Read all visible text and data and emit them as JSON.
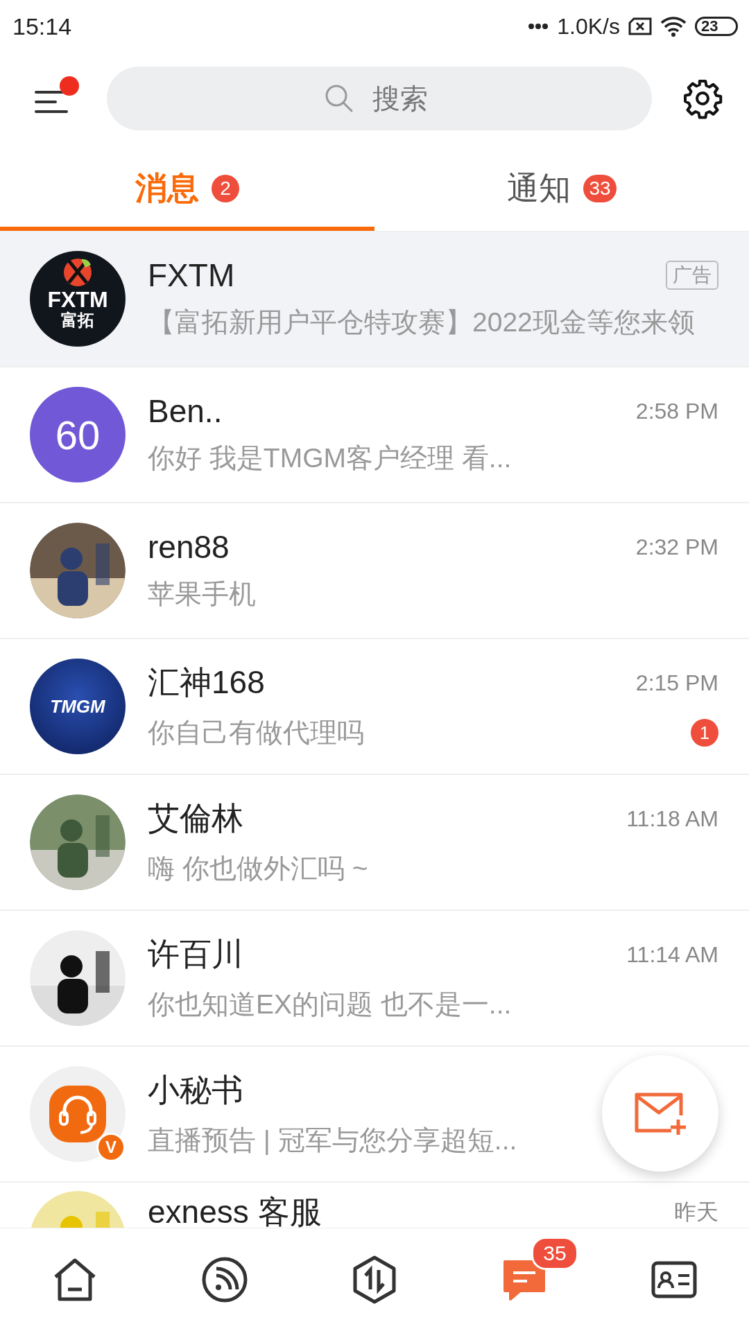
{
  "status_bar": {
    "time": "15:14",
    "net_speed": "1.0K/s",
    "battery": "23"
  },
  "header": {
    "menu_notification": true,
    "search": {
      "placeholder": "搜索"
    }
  },
  "tabs": [
    {
      "label": "消息",
      "badge": "2",
      "selected": true
    },
    {
      "label": "通知",
      "badge": "33",
      "selected": false
    }
  ],
  "conversations": [
    {
      "name": "FXTM",
      "preview": "【富拓新用户平仓特攻赛】2022现金等您来领",
      "tag": "广告",
      "highlighted": true,
      "avatar": {
        "kind": "logo",
        "text": "FXTM",
        "subtext": "富拓"
      }
    },
    {
      "name": "Ben..",
      "time": "2:58 PM",
      "preview": "你好 我是TMGM客户经理 看...",
      "highlighted": false,
      "avatar": {
        "kind": "initials",
        "text": "60",
        "color": "#7158d6"
      }
    },
    {
      "name": "ren88",
      "time": "2:32 PM",
      "preview": "苹果手机",
      "highlighted": false
    },
    {
      "name": "汇神168",
      "time": "2:15 PM",
      "preview": "你自己有做代理吗",
      "unread": "1",
      "highlighted": false,
      "avatar": {
        "kind": "brand",
        "text": "TMGM"
      }
    },
    {
      "name": "艾倫林",
      "time": "11:18 AM",
      "preview": "嗨 你也做外汇吗 ~",
      "highlighted": false
    },
    {
      "name": "许百川",
      "time": "11:14 AM",
      "preview": "你也知道EX的问题 也不是一...",
      "highlighted": false
    },
    {
      "name": "小秘书",
      "preview": "直播预告 | 冠军与您分享超短...",
      "highlighted": false,
      "avatar": {
        "kind": "headset",
        "verified": "V"
      }
    },
    {
      "name": "exness 客服",
      "time": "昨天",
      "highlighted": false
    }
  ],
  "bottom_nav": [
    {
      "selected": false
    },
    {
      "selected": false
    },
    {
      "selected": false
    },
    {
      "badge": "35",
      "selected": true
    },
    {
      "selected": false
    }
  ]
}
